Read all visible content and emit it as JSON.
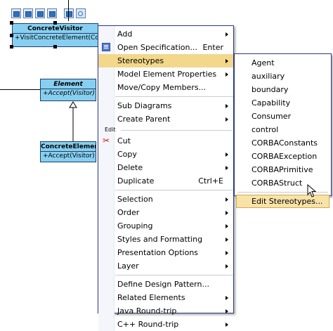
{
  "diagram": {
    "classes": [
      {
        "name": "ConcreteVisitor",
        "operation": "+VisitConcreteElement(Concre"
      },
      {
        "name": "Element",
        "operation": "+Accept(Visitor)"
      },
      {
        "name": "ConcreteElement",
        "operation": "+Accept(Visitor)"
      }
    ]
  },
  "context_menu": {
    "items": [
      {
        "label": "Add",
        "submenu": true
      },
      {
        "label": "Open Specification...",
        "shortcut": "Enter",
        "icon": "specification-icon"
      },
      {
        "label": "Stereotypes",
        "submenu": true,
        "highlighted": true
      },
      {
        "label": "Model Element Properties",
        "submenu": true
      },
      {
        "label": "Move/Copy Members..."
      },
      {
        "label": "Sub Diagrams",
        "submenu": true
      },
      {
        "label": "Create Parent",
        "submenu": true
      },
      {
        "label": "Cut",
        "icon": "scissors-icon"
      },
      {
        "label": "Copy",
        "submenu": true
      },
      {
        "label": "Delete",
        "submenu": true
      },
      {
        "label": "Duplicate",
        "shortcut": "Ctrl+E"
      },
      {
        "label": "Selection",
        "submenu": true
      },
      {
        "label": "Order",
        "submenu": true
      },
      {
        "label": "Grouping",
        "submenu": true
      },
      {
        "label": "Styles and Formatting",
        "submenu": true
      },
      {
        "label": "Presentation Options",
        "submenu": true
      },
      {
        "label": "Layer",
        "submenu": true
      },
      {
        "label": "Define Design Pattern..."
      },
      {
        "label": "Related Elements",
        "submenu": true
      },
      {
        "label": "Java Round-trip",
        "submenu": true
      },
      {
        "label": "C++ Round-trip",
        "submenu": true
      }
    ],
    "group_header": "Edit"
  },
  "stereotypes_submenu": {
    "items": [
      "Agent",
      "auxiliary",
      "boundary",
      "Capability",
      "Consumer",
      "control",
      "CORBAConstants",
      "CORBAException",
      "CORBAPrimitive",
      "CORBAStruct"
    ],
    "edit_label": "Edit Stereotypes..."
  },
  "colors": {
    "menu_border": "#2b3a8c",
    "highlight": "#f3d78a",
    "class_fill": "#87cff0"
  }
}
